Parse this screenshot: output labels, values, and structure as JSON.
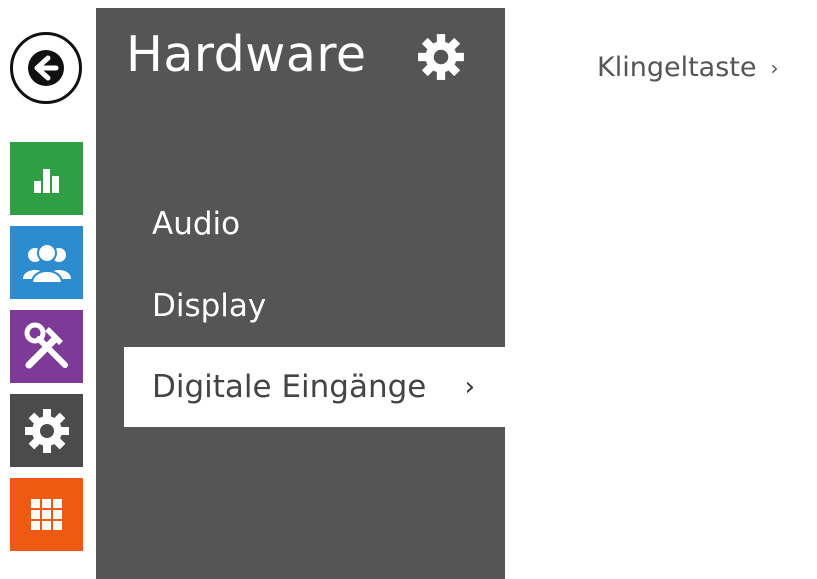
{
  "rail": {
    "back_icon": "arrow-left-icon",
    "tiles": [
      {
        "name": "status",
        "icon": "bar-chart-icon",
        "color": "#2f9e44"
      },
      {
        "name": "directory",
        "icon": "users-icon",
        "color": "#2d8ccf"
      },
      {
        "name": "services",
        "icon": "hammer-wrench-icon",
        "color": "#7d3a97"
      },
      {
        "name": "hardware",
        "icon": "gear-icon",
        "color": "#4b4b4b"
      },
      {
        "name": "system",
        "icon": "grid-icon",
        "color": "#ee5a12"
      }
    ]
  },
  "menu": {
    "title": "Hardware",
    "title_icon": "gear-icon",
    "items": [
      {
        "label": "Audio"
      },
      {
        "label": "Display"
      },
      {
        "label": "Digitale Eingänge",
        "chevron": "›",
        "selected": true
      }
    ]
  },
  "content": {
    "sub_link": {
      "label": "Klingeltaste",
      "chevron": "›"
    }
  },
  "colors": {
    "panel": "#555555",
    "selected_bg": "#ffffff"
  }
}
